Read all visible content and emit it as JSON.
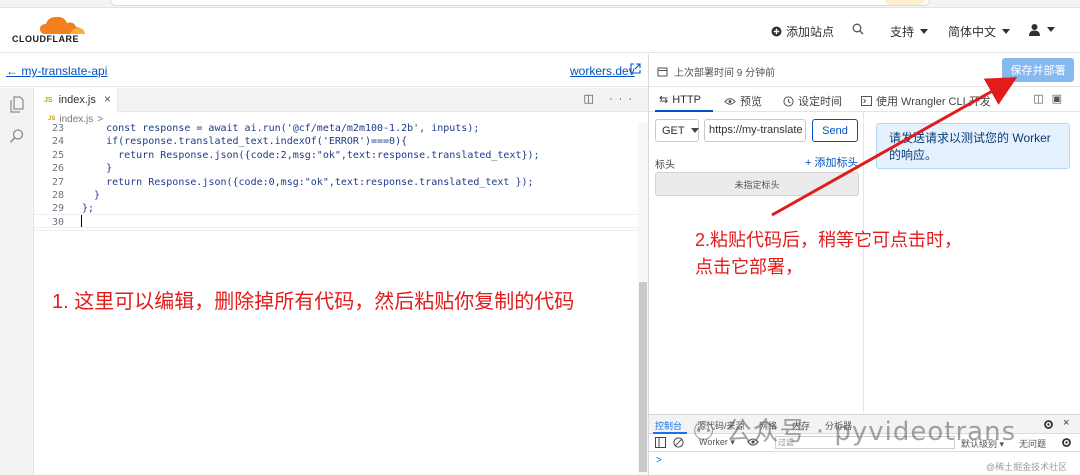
{
  "brand": {
    "logo_text": "CLOUDFLARE",
    "logo_color": "#f38020"
  },
  "topnav": {
    "add_site": "添加站点",
    "support": "支持",
    "language": "简体中文"
  },
  "editor_header": {
    "back_label": "my-translate-api",
    "workers_link": "workers.dev"
  },
  "file_tab": {
    "badge": "JS",
    "name": "index.js",
    "close": "×"
  },
  "tab_actions": "◫ ···",
  "breadcrumb": {
    "badge": "JS",
    "file": "index.js",
    "sep": ">"
  },
  "code_lines": [
    {
      "num": "23",
      "text": "    const response = await ai.run('@cf/meta/m2m100-1.2b', inputs);"
    },
    {
      "num": "24",
      "text": "    if(response.translated_text.indexOf('ERROR')===0){"
    },
    {
      "num": "25",
      "text": "      return Response.json({code:2,msg:\"ok\",text:response.translated_text});"
    },
    {
      "num": "26",
      "text": "    }"
    },
    {
      "num": "27",
      "text": "    return Response.json({code:0,msg:\"ok\",text:response.translated_text });"
    },
    {
      "num": "28",
      "text": "  }"
    },
    {
      "num": "29",
      "text": "};"
    },
    {
      "num": "30",
      "text": ""
    }
  ],
  "annotation_left": "1. 这里可以编辑，删除掉所有代码，然后粘贴你复制的代码",
  "deploy_bar": {
    "status": "上次部署时间 9 分钟前",
    "save_button": "保存并部署"
  },
  "panel_tabs": {
    "http": "HTTP",
    "preview": "预览",
    "schedule": "设定时间",
    "wrangler": "使用 Wrangler CLI 开发"
  },
  "request": {
    "method": "GET",
    "url": "https://my-translate",
    "send": "Send",
    "headers_label": "标头",
    "add_header": "+ 添加标头",
    "no_headers": "未指定标头"
  },
  "info_box": "请发送请求以测试您的 Worker 的响应。",
  "annotation_right": {
    "line1": "2.粘贴代码后，稍等它可点击时，",
    "line2": "点击它部署，"
  },
  "devtools": {
    "tabs": [
      "控制台",
      "源代码/来源",
      "网络",
      "内存",
      "分析器"
    ],
    "context": "Worker",
    "filter_placeholder": "过滤",
    "level": "默认级别",
    "issues": "无问题",
    "prompt": ">"
  },
  "watermark": "公众号 · pyvideotrans",
  "watermark_small": "@稀土掘金技术社区",
  "colors": {
    "link": "#0051c3",
    "annotation": "#e21b1b",
    "save_button": "#86b9f0",
    "info_bg": "#e5f1fd"
  }
}
